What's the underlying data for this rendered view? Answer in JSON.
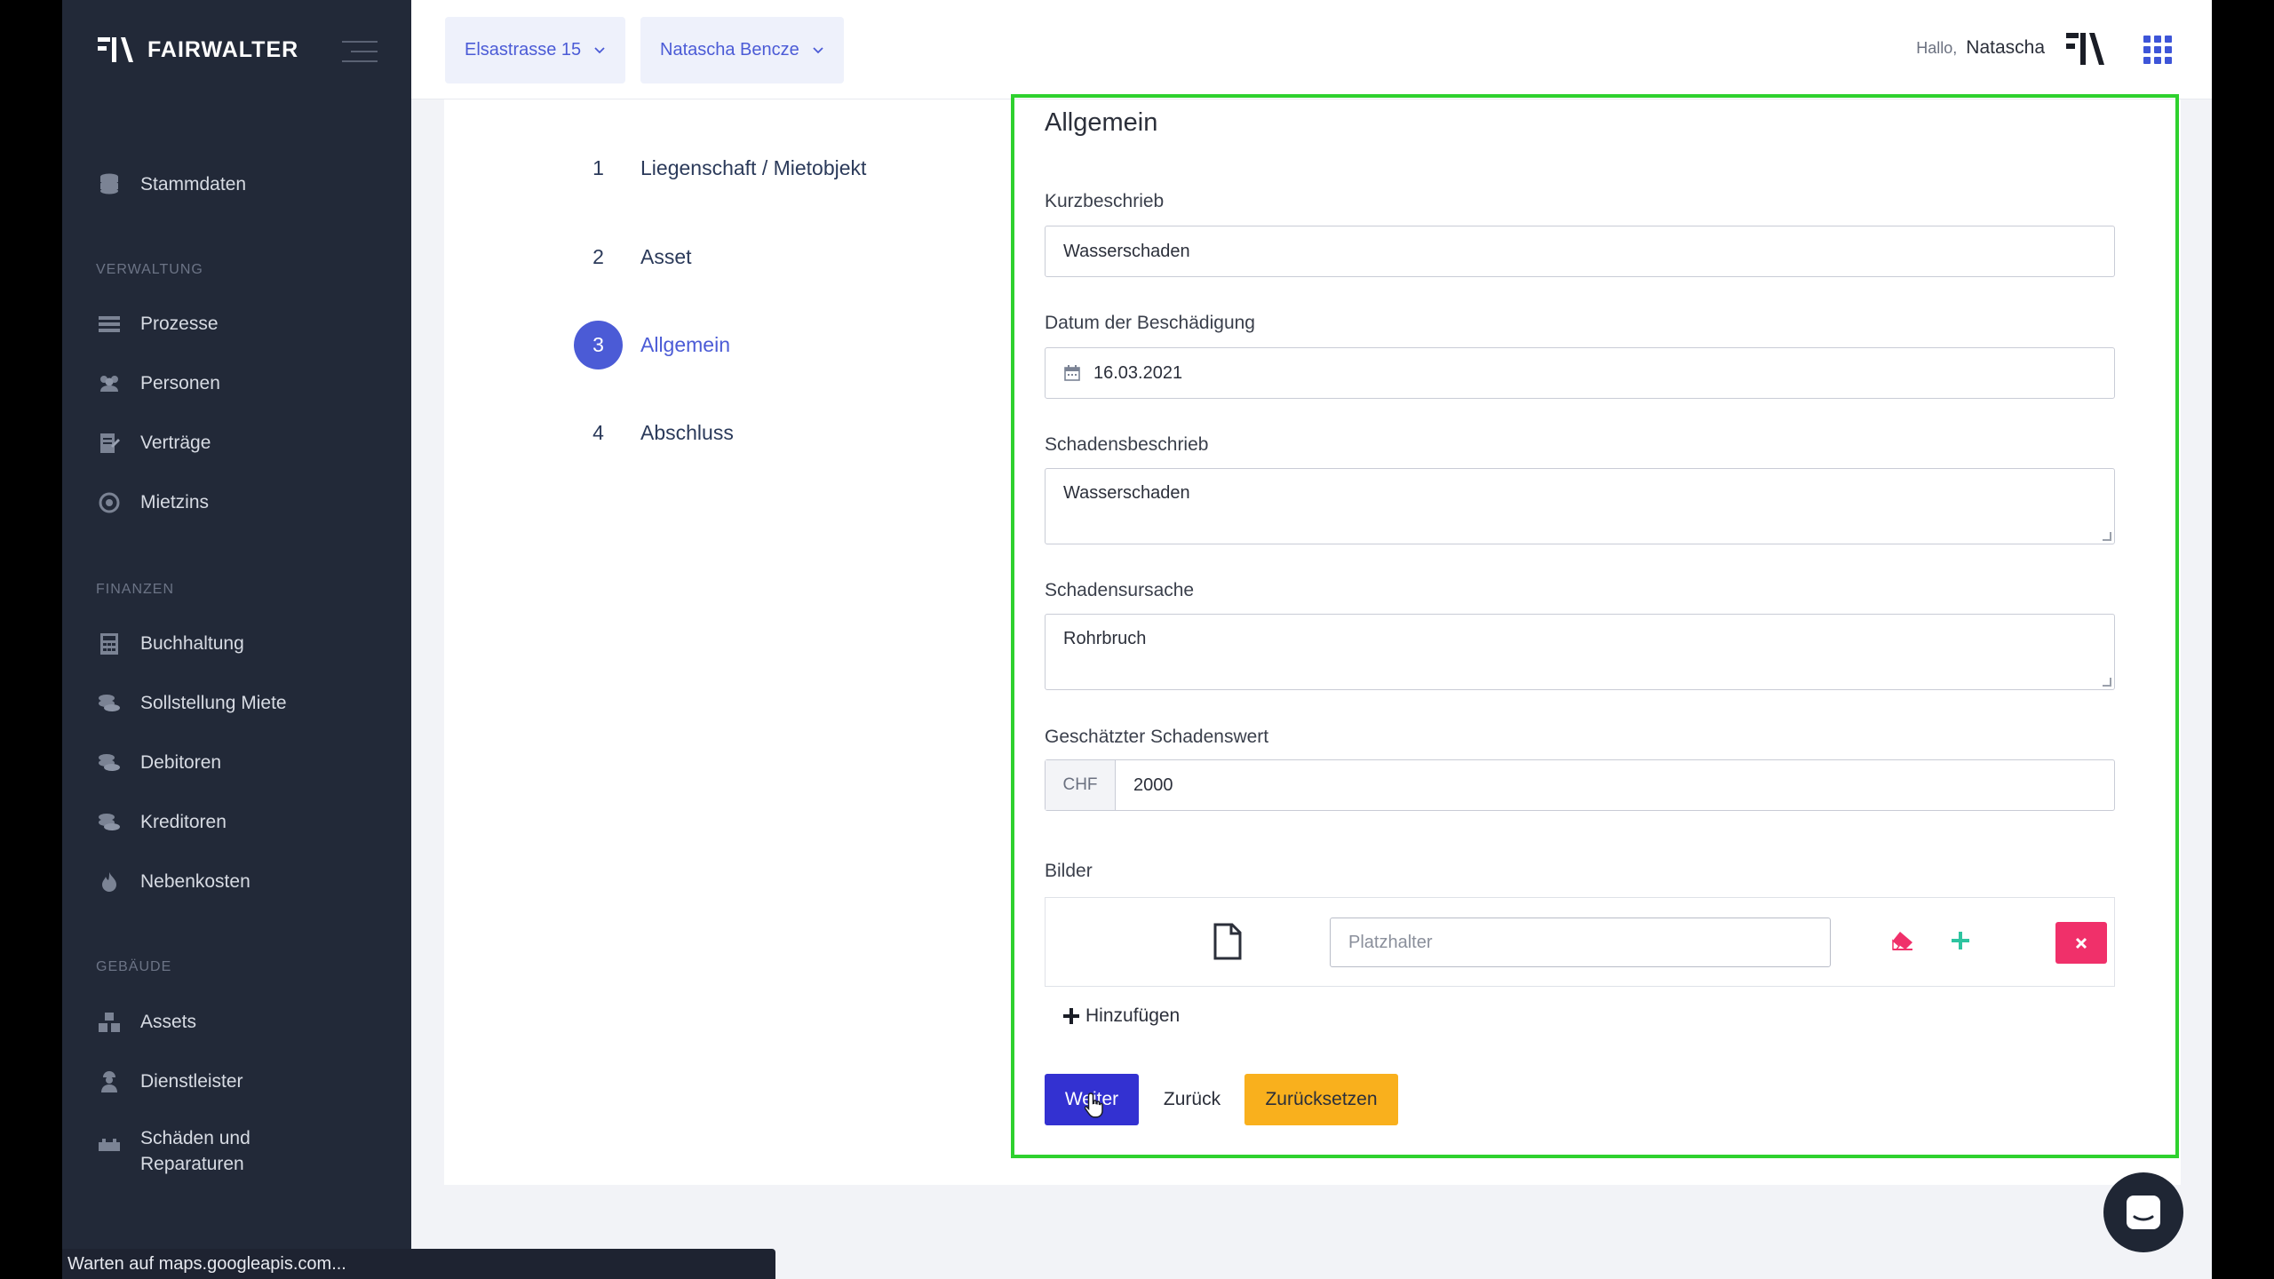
{
  "brand": {
    "name": "FAIRWALTER"
  },
  "sidebar": {
    "top_item": {
      "label": "Stammdaten"
    },
    "sections": [
      {
        "title": "VERWALTUNG",
        "items": [
          "Prozesse",
          "Personen",
          "Verträge",
          "Mietzins"
        ]
      },
      {
        "title": "FINANZEN",
        "items": [
          "Buchhaltung",
          "Sollstellung Miete",
          "Debitoren",
          "Kreditoren",
          "Nebenkosten"
        ]
      },
      {
        "title": "GEBÄUDE",
        "items": [
          "Assets",
          "Dienstleister",
          "Schäden und Reparaturen"
        ]
      }
    ]
  },
  "header": {
    "property_select": "Elsastrasse 15",
    "user_select": "Natascha Bencze",
    "greeting": "Hallo,",
    "user_name": "Natascha"
  },
  "steps": [
    {
      "num": "1",
      "label": "Liegenschaft / Mietobjekt"
    },
    {
      "num": "2",
      "label": "Asset"
    },
    {
      "num": "3",
      "label": "Allgemein"
    },
    {
      "num": "4",
      "label": "Abschluss"
    }
  ],
  "form": {
    "title": "Allgemein",
    "kurzbeschrieb_label": "Kurzbeschrieb",
    "kurzbeschrieb_value": "Wasserschaden",
    "datum_label": "Datum der Beschädigung",
    "datum_value": "16.03.2021",
    "schadensbeschrieb_label": "Schadensbeschrieb",
    "schadensbeschrieb_value": "Wasserschaden",
    "schadensursache_label": "Schadensursache",
    "schadensursache_value": "Rohrbruch",
    "schadenswert_label": "Geschätzter Schadenswert",
    "currency": "CHF",
    "schadenswert_value": "2000",
    "bilder_label": "Bilder",
    "bilder_placeholder": "Platzhalter",
    "add_label": "Hinzufügen",
    "btn_next": "Weiter",
    "btn_back": "Zurück",
    "btn_reset": "Zurücksetzen"
  },
  "status_bar": "Warten auf maps.googleapis.com...",
  "colors": {
    "accent": "#4b5bd6",
    "sidebar": "#222938",
    "warning": "#f9b01d",
    "danger": "#f0306a",
    "success": "#2ec4a0",
    "highlight": "#2ed12e"
  }
}
